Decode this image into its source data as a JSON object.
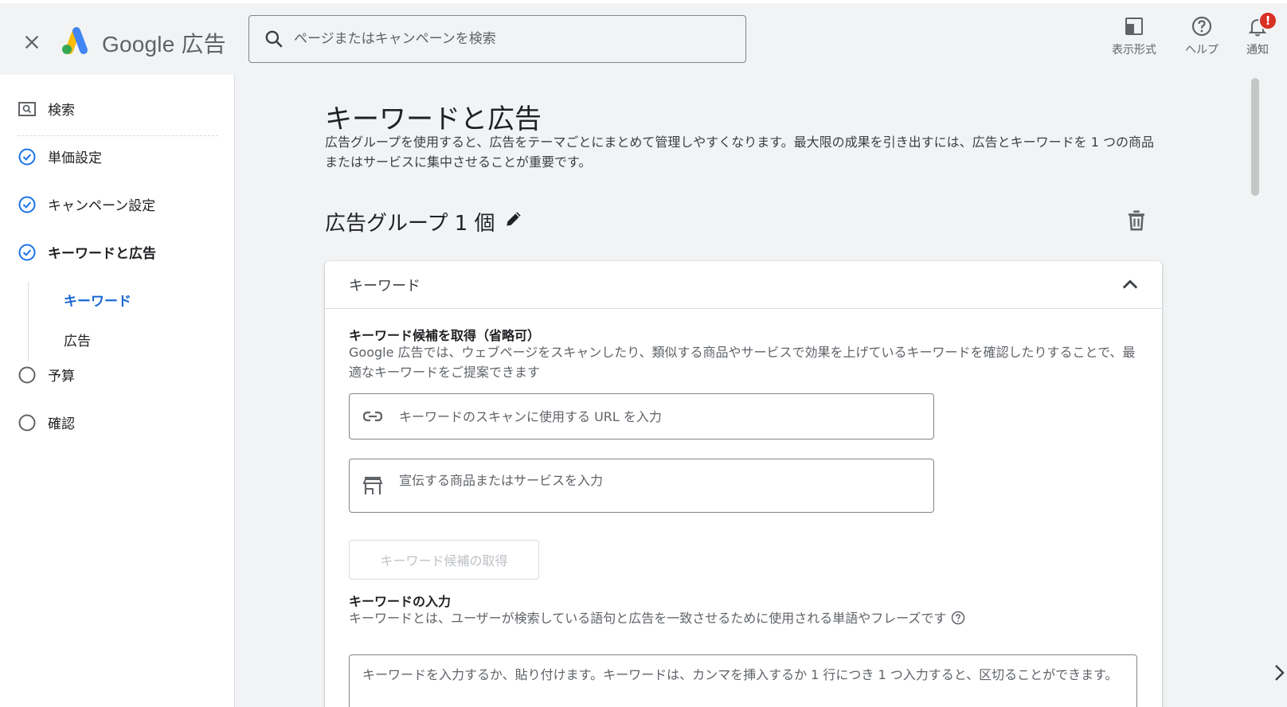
{
  "header": {
    "brand": "Google 広告",
    "search_placeholder": "ページまたはキャンペーンを検索",
    "actions": [
      {
        "label": "表示形式",
        "icon": "appearance-icon"
      },
      {
        "label": "ヘルプ",
        "icon": "help-icon"
      },
      {
        "label": "通知",
        "icon": "bell-icon",
        "badge": "!"
      }
    ]
  },
  "sidebar": {
    "search_label": "検索",
    "steps": [
      {
        "label": "単価設定",
        "status": "done"
      },
      {
        "label": "キャンペーン設定",
        "status": "done"
      },
      {
        "label": "キーワードと広告",
        "status": "done"
      },
      {
        "label": "予算",
        "status": "todo"
      },
      {
        "label": "確認",
        "status": "todo"
      }
    ],
    "sub_items": [
      {
        "label": "キーワード",
        "active": true
      },
      {
        "label": "広告",
        "active": false
      }
    ]
  },
  "main": {
    "title": "キーワードと広告",
    "description": "広告グループを使用すると、広告をテーマごとにまとめて管理しやすくなります。最大限の成果を引き出すには、広告とキーワードを 1 つの商品またはサービスに集中させることが重要です。",
    "ad_group_title": "広告グループ 1 個",
    "card": {
      "header": "キーワード",
      "suggest_title": "キーワード候補を取得（省略可）",
      "suggest_desc": "Google 広告では、ウェブページをスキャンしたり、類似する商品やサービスで効果を上げているキーワードを確認したりすることで、最適なキーワードをご提案できます",
      "url_placeholder": "キーワードのスキャンに使用する URL を入力",
      "product_placeholder": "宣伝する商品またはサービスを入力",
      "get_button": "キーワード候補の取得",
      "input_title": "キーワードの入力",
      "input_desc": "キーワードとは、ユーザーが検索している語句と広告を一致させるために使用される単語やフレーズです",
      "textarea_placeholder": "キーワードを入力するか、貼り付けます。キーワードは、カンマを挿入するか 1 行につき 1 つ入力すると、区切ることができます。"
    }
  },
  "colors": {
    "accent": "#1a73e8",
    "active_text": "#1967d2",
    "badge": "#d93025",
    "background": "#f1f3f4"
  }
}
